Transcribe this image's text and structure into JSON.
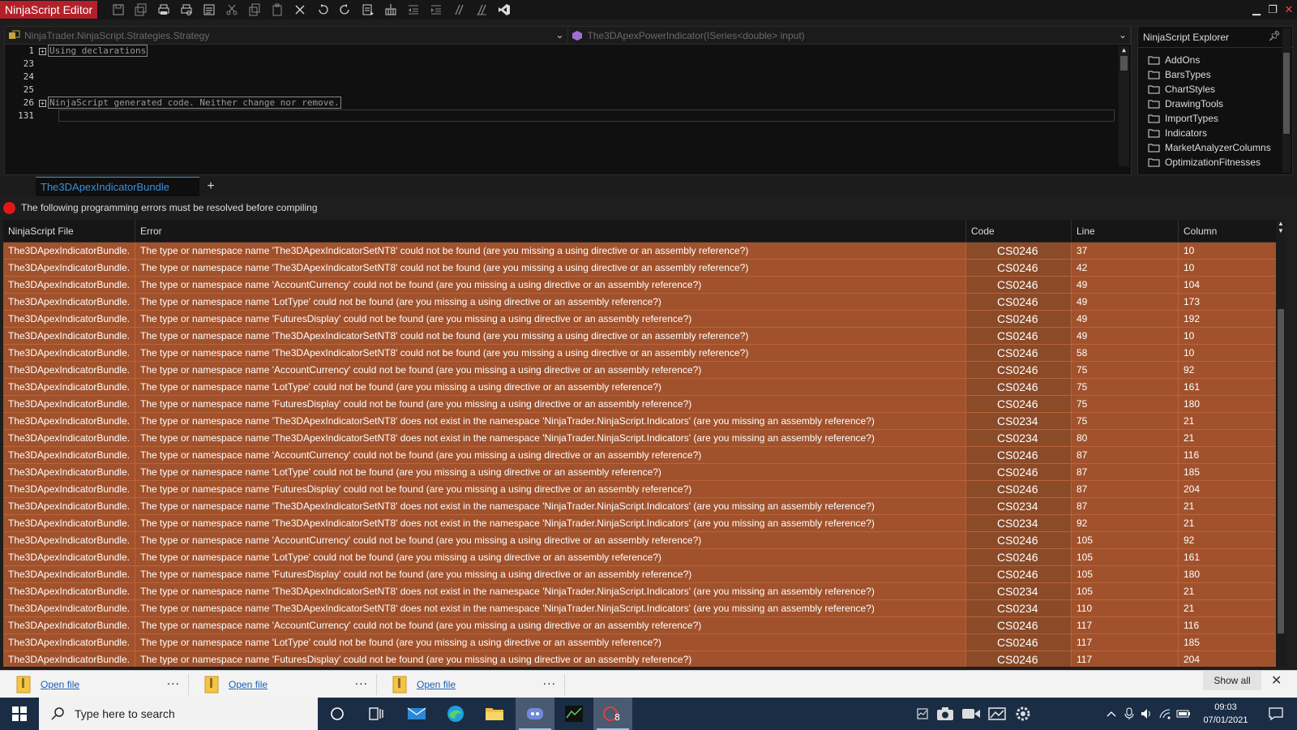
{
  "window": {
    "title": "NinjaScript Editor",
    "controls": {
      "minimize": "▁",
      "restore": "❐",
      "close": "✕"
    }
  },
  "toolbar_icons": [
    "save-icon",
    "save-all-icon",
    "print-icon",
    "print-preview-icon",
    "format-icon",
    "cut-icon",
    "copy-icon",
    "paste-icon",
    "delete-icon",
    "undo-icon",
    "redo-icon",
    "compile-icon",
    "reference-icon",
    "outdent-icon",
    "indent-icon",
    "comment-icon",
    "uncomment-icon",
    "visual-studio-icon"
  ],
  "editor": {
    "class_combo": "NinjaTrader.NinjaScript.Strategies.Strategy",
    "member_combo": "The3DApexPowerIndicator(ISeries<double> input)",
    "line_numbers": [
      "1",
      "23",
      "24",
      "25",
      "26",
      "131"
    ],
    "line1_region": "Using declarations",
    "line26_region": "NinjaScript generated code. Neither change nor remove."
  },
  "explorer": {
    "title": "NinjaScript Explorer",
    "items": [
      "AddOns",
      "BarsTypes",
      "ChartStyles",
      "DrawingTools",
      "ImportTypes",
      "Indicators",
      "MarketAnalyzerColumns",
      "OptimizationFitnesses"
    ]
  },
  "tabs": {
    "active": "The3DApexIndicatorBundle",
    "add": "+"
  },
  "status": {
    "message": "The following programming errors must be resolved before compiling"
  },
  "errors": {
    "headers": {
      "file": "NinjaScript File",
      "error": "Error",
      "code": "Code",
      "line": "Line",
      "column": "Column"
    },
    "rows": [
      {
        "file": "The3DApexIndicatorBundle.",
        "error": "The type or namespace name 'The3DApexIndicatorSetNT8' could not be found (are you missing a using directive or an assembly reference?)",
        "code": "CS0246",
        "line": "37",
        "column": "10"
      },
      {
        "file": "The3DApexIndicatorBundle.",
        "error": "The type or namespace name 'The3DApexIndicatorSetNT8' could not be found (are you missing a using directive or an assembly reference?)",
        "code": "CS0246",
        "line": "42",
        "column": "10"
      },
      {
        "file": "The3DApexIndicatorBundle.",
        "error": "The type or namespace name 'AccountCurrency' could not be found (are you missing a using directive or an assembly reference?)",
        "code": "CS0246",
        "line": "49",
        "column": "104"
      },
      {
        "file": "The3DApexIndicatorBundle.",
        "error": "The type or namespace name 'LotType' could not be found (are you missing a using directive or an assembly reference?)",
        "code": "CS0246",
        "line": "49",
        "column": "173"
      },
      {
        "file": "The3DApexIndicatorBundle.",
        "error": "The type or namespace name 'FuturesDisplay' could not be found (are you missing a using directive or an assembly reference?)",
        "code": "CS0246",
        "line": "49",
        "column": "192"
      },
      {
        "file": "The3DApexIndicatorBundle.",
        "error": "The type or namespace name 'The3DApexIndicatorSetNT8' could not be found (are you missing a using directive or an assembly reference?)",
        "code": "CS0246",
        "line": "49",
        "column": "10"
      },
      {
        "file": "The3DApexIndicatorBundle.",
        "error": "The type or namespace name 'The3DApexIndicatorSetNT8' could not be found (are you missing a using directive or an assembly reference?)",
        "code": "CS0246",
        "line": "58",
        "column": "10"
      },
      {
        "file": "The3DApexIndicatorBundle.",
        "error": "The type or namespace name 'AccountCurrency' could not be found (are you missing a using directive or an assembly reference?)",
        "code": "CS0246",
        "line": "75",
        "column": "92"
      },
      {
        "file": "The3DApexIndicatorBundle.",
        "error": "The type or namespace name 'LotType' could not be found (are you missing a using directive or an assembly reference?)",
        "code": "CS0246",
        "line": "75",
        "column": "161"
      },
      {
        "file": "The3DApexIndicatorBundle.",
        "error": "The type or namespace name 'FuturesDisplay' could not be found (are you missing a using directive or an assembly reference?)",
        "code": "CS0246",
        "line": "75",
        "column": "180"
      },
      {
        "file": "The3DApexIndicatorBundle.",
        "error": "The type or namespace name 'The3DApexIndicatorSetNT8' does not exist in the namespace 'NinjaTrader.NinjaScript.Indicators' (are you missing an assembly reference?)",
        "code": "CS0234",
        "line": "75",
        "column": "21"
      },
      {
        "file": "The3DApexIndicatorBundle.",
        "error": "The type or namespace name 'The3DApexIndicatorSetNT8' does not exist in the namespace 'NinjaTrader.NinjaScript.Indicators' (are you missing an assembly reference?)",
        "code": "CS0234",
        "line": "80",
        "column": "21"
      },
      {
        "file": "The3DApexIndicatorBundle.",
        "error": "The type or namespace name 'AccountCurrency' could not be found (are you missing a using directive or an assembly reference?)",
        "code": "CS0246",
        "line": "87",
        "column": "116"
      },
      {
        "file": "The3DApexIndicatorBundle.",
        "error": "The type or namespace name 'LotType' could not be found (are you missing a using directive or an assembly reference?)",
        "code": "CS0246",
        "line": "87",
        "column": "185"
      },
      {
        "file": "The3DApexIndicatorBundle.",
        "error": "The type or namespace name 'FuturesDisplay' could not be found (are you missing a using directive or an assembly reference?)",
        "code": "CS0246",
        "line": "87",
        "column": "204"
      },
      {
        "file": "The3DApexIndicatorBundle.",
        "error": "The type or namespace name 'The3DApexIndicatorSetNT8' does not exist in the namespace 'NinjaTrader.NinjaScript.Indicators' (are you missing an assembly reference?)",
        "code": "CS0234",
        "line": "87",
        "column": "21"
      },
      {
        "file": "The3DApexIndicatorBundle.",
        "error": "The type or namespace name 'The3DApexIndicatorSetNT8' does not exist in the namespace 'NinjaTrader.NinjaScript.Indicators' (are you missing an assembly reference?)",
        "code": "CS0234",
        "line": "92",
        "column": "21"
      },
      {
        "file": "The3DApexIndicatorBundle.",
        "error": "The type or namespace name 'AccountCurrency' could not be found (are you missing a using directive or an assembly reference?)",
        "code": "CS0246",
        "line": "105",
        "column": "92"
      },
      {
        "file": "The3DApexIndicatorBundle.",
        "error": "The type or namespace name 'LotType' could not be found (are you missing a using directive or an assembly reference?)",
        "code": "CS0246",
        "line": "105",
        "column": "161"
      },
      {
        "file": "The3DApexIndicatorBundle.",
        "error": "The type or namespace name 'FuturesDisplay' could not be found (are you missing a using directive or an assembly reference?)",
        "code": "CS0246",
        "line": "105",
        "column": "180"
      },
      {
        "file": "The3DApexIndicatorBundle.",
        "error": "The type or namespace name 'The3DApexIndicatorSetNT8' does not exist in the namespace 'NinjaTrader.NinjaScript.Indicators' (are you missing an assembly reference?)",
        "code": "CS0234",
        "line": "105",
        "column": "21"
      },
      {
        "file": "The3DApexIndicatorBundle.",
        "error": "The type or namespace name 'The3DApexIndicatorSetNT8' does not exist in the namespace 'NinjaTrader.NinjaScript.Indicators' (are you missing an assembly reference?)",
        "code": "CS0234",
        "line": "110",
        "column": "21"
      },
      {
        "file": "The3DApexIndicatorBundle.",
        "error": "The type or namespace name 'AccountCurrency' could not be found (are you missing a using directive or an assembly reference?)",
        "code": "CS0246",
        "line": "117",
        "column": "116"
      },
      {
        "file": "The3DApexIndicatorBundle.",
        "error": "The type or namespace name 'LotType' could not be found (are you missing a using directive or an assembly reference?)",
        "code": "CS0246",
        "line": "117",
        "column": "185"
      },
      {
        "file": "The3DApexIndicatorBundle.",
        "error": "The type or namespace name 'FuturesDisplay' could not be found (are you missing a using directive or an assembly reference?)",
        "code": "CS0246",
        "line": "117",
        "column": "204"
      }
    ]
  },
  "downloads": {
    "items": [
      {
        "open": "Open file",
        "more": "..."
      },
      {
        "open": "Open file",
        "more": "..."
      },
      {
        "open": "Open file",
        "more": "..."
      }
    ],
    "show_all": "Show all",
    "close": "✕"
  },
  "taskbar": {
    "search_placeholder": "Type here to search",
    "apps": [
      "cortana-icon",
      "task-view-icon",
      "mail-icon",
      "edge-icon",
      "file-explorer-icon",
      "discord-icon",
      "ninjatrader-icon",
      "ninjatrader-8-icon"
    ],
    "time": "09:03",
    "date": "07/01/2021"
  },
  "colors": {
    "title_accent": "#b3202a",
    "error_row": "#a1522c",
    "tab_accent": "#3f8fd8",
    "error_dot": "#e01818",
    "taskbar": "#1b2d45"
  }
}
